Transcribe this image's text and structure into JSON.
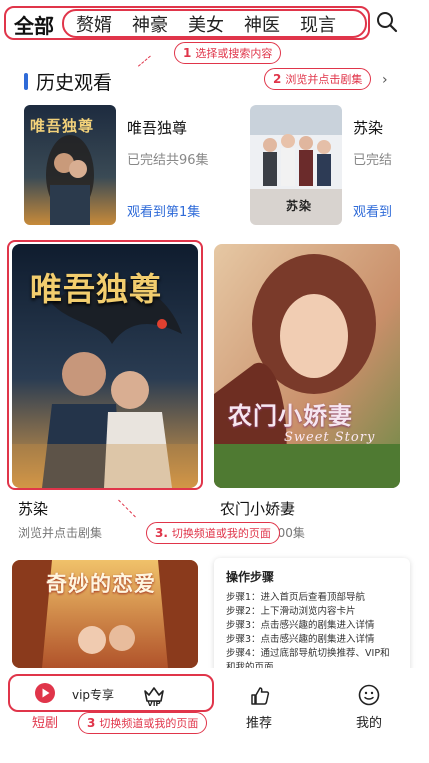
{
  "topnav": {
    "active": "全部",
    "categories": [
      "赘婿",
      "神豪",
      "美女",
      "神医",
      "现言"
    ]
  },
  "annotations": {
    "step1": {
      "num": "1",
      "text": "选择或搜索内容"
    },
    "step2": {
      "num": "2",
      "text": "浏览并点击剧集"
    },
    "step3a": {
      "num": "3.",
      "text": "切换频道或我的页面"
    },
    "step3b": {
      "num": "3",
      "text": "切换频道或我的页面"
    }
  },
  "history": {
    "title": "历史观看",
    "items": [
      {
        "title": "唯吾独尊",
        "meta": "已完结共96集",
        "progress": "观看到第1集",
        "cover_text": "唯吾独尊"
      },
      {
        "title": "苏染",
        "meta": "已完结",
        "progress": "观看到",
        "cover_text": "苏染"
      }
    ]
  },
  "feed": {
    "items": [
      {
        "title": "苏染",
        "sub": "浏览并点击剧集",
        "cover_text": "唯吾独尊"
      },
      {
        "title": "农门小娇妻",
        "sub": "100集",
        "cover_text": "农门小娇妻",
        "cover_subtext": "Sweet Story"
      },
      {
        "title": "",
        "sub": "",
        "cover_text": "奇妙的恋爱"
      }
    ]
  },
  "steps_panel": {
    "title": "操作步骤",
    "steps": [
      "步骤1：进入首页后查看顶部导航",
      "步骤2：上下滑动浏览内容卡片",
      "步骤3：点击感兴趣的剧集进入详情",
      "步骤3：点击感兴趣的剧集进入详情",
      "步骤4：通过底部导航切换推荐、VIP和",
      "和我的页面"
    ]
  },
  "tabbar": {
    "tabs": [
      {
        "label": "短剧",
        "icon": "play-icon",
        "active": true
      },
      {
        "label": "vip专享",
        "icon": "vip-crown-icon",
        "active": false
      },
      {
        "label": "推荐",
        "icon": "thumbs-up-icon",
        "active": false
      },
      {
        "label": "我的",
        "icon": "smile-face-icon",
        "active": false
      }
    ]
  },
  "colors": {
    "accent_red": "#e0354a",
    "link_blue": "#2f6bd8"
  }
}
